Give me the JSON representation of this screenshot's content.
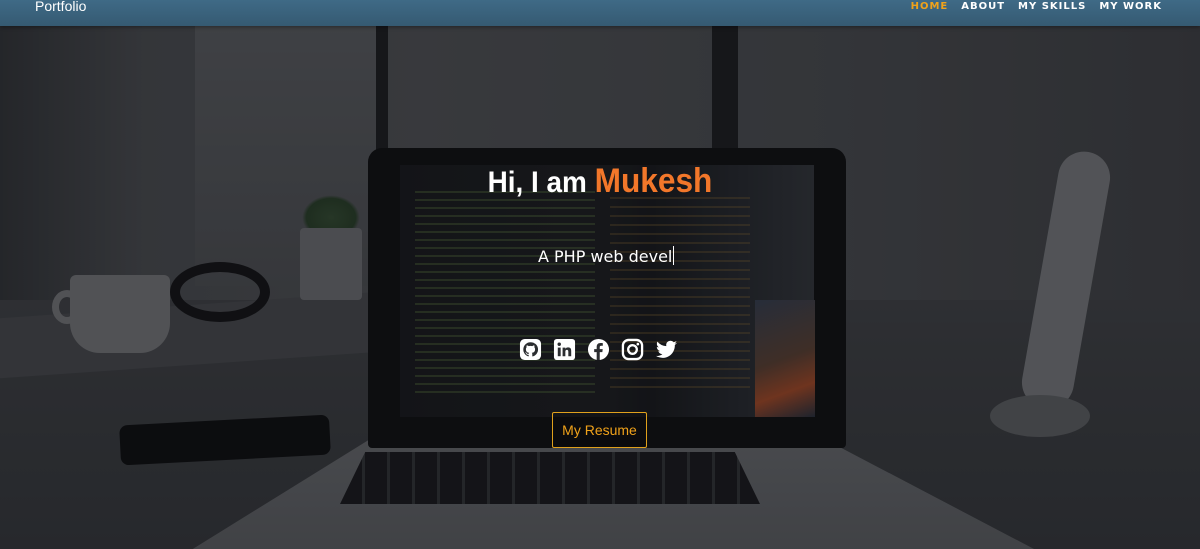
{
  "navbar": {
    "brand": "Portfolio",
    "links": [
      {
        "label": "HOME",
        "active": true
      },
      {
        "label": "ABOUT",
        "active": false
      },
      {
        "label": "MY SKILLS",
        "active": false
      },
      {
        "label": "MY WORK",
        "active": false
      }
    ]
  },
  "hero": {
    "greeting": "Hi, I am",
    "name": "Mukesh",
    "typed_text": "A PHP web devel",
    "social_icons": [
      "github-icon",
      "linkedin-icon",
      "facebook-icon",
      "instagram-icon",
      "twitter-icon"
    ],
    "resume_button": "My Resume"
  },
  "colors": {
    "navbar": "#3f6a86",
    "accent_active": "#f0a21a",
    "name": "#f2772a",
    "button_border": "#e0a11c"
  }
}
